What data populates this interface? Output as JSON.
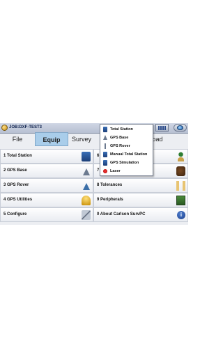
{
  "window": {
    "title": "JOB:DXF-TEST3"
  },
  "tabs": [
    "File",
    "Equip",
    "Survey",
    "Road"
  ],
  "active_tab": "Equip",
  "menu_items": [
    {
      "num": "1",
      "label": "Total Station",
      "icon": "total-station-icon"
    },
    {
      "num": "2",
      "label": "GPS Base",
      "icon": "gps-base-icon"
    },
    {
      "num": "3",
      "label": "GPS Rover",
      "icon": "gps-rover-icon"
    },
    {
      "num": "4",
      "label": "GPS Utilities",
      "icon": "gps-utilities-icon"
    },
    {
      "num": "5",
      "label": "Configure",
      "icon": "configure-icon"
    },
    {
      "num": "6",
      "label": "",
      "icon": "person-icon"
    },
    {
      "num": "7",
      "label": "",
      "icon": "device-icon"
    },
    {
      "num": "8",
      "label": "Tolerances",
      "icon": "tolerances-icon"
    },
    {
      "num": "9",
      "label": "Peripherals",
      "icon": "peripherals-icon"
    },
    {
      "num": "0",
      "label": "About Carlson SurvPC",
      "icon": "info-icon"
    }
  ],
  "dropdown": {
    "items": [
      {
        "label": "Total Station",
        "icon": "total-station-icon"
      },
      {
        "label": "GPS Base",
        "icon": "gps-base-icon"
      },
      {
        "label": "GPS Rover",
        "icon": "gps-rover-icon"
      },
      {
        "label": "Manual Total Station",
        "icon": "manual-total-station-icon"
      },
      {
        "label": "GPS Simulation",
        "icon": "gps-simulation-icon"
      },
      {
        "label": "Laser",
        "icon": "laser-icon"
      }
    ]
  },
  "info_glyph": "i"
}
